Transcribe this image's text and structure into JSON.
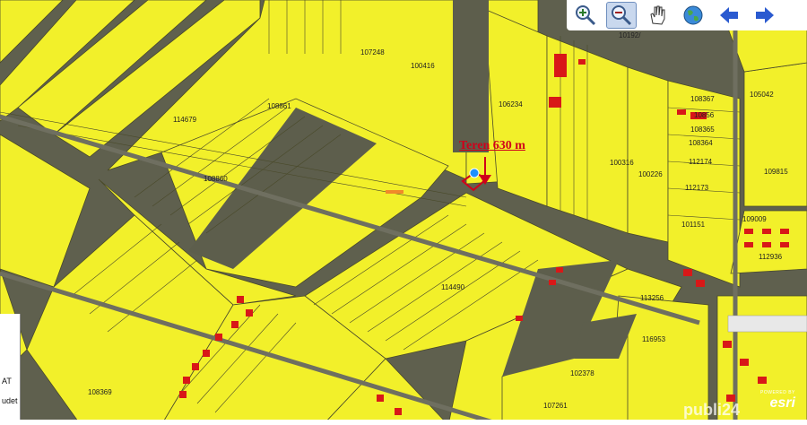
{
  "toolbar": {
    "buttons": [
      {
        "name": "zoom-in-button",
        "icon": "zoom-in-icon"
      },
      {
        "name": "zoom-out-button",
        "icon": "zoom-out-icon",
        "active": true
      },
      {
        "name": "pan-button",
        "icon": "pan-hand-icon"
      },
      {
        "name": "full-extent-button",
        "icon": "globe-icon"
      },
      {
        "name": "previous-extent-button",
        "icon": "arrow-left-icon"
      },
      {
        "name": "next-extent-button",
        "icon": "arrow-right-icon"
      }
    ]
  },
  "annotation": {
    "label": "Teren 630 m",
    "color": "#d0001a"
  },
  "parcels": [
    "107248",
    "100416",
    "10192/",
    "114679",
    "108861",
    "106234",
    "108367",
    "105042",
    "10856",
    "108365",
    "108364",
    "112174",
    "109815",
    "100316",
    "100226",
    "112173",
    "108860",
    "101151",
    "109009",
    "112936",
    "114490",
    "113256",
    "116953",
    "102378",
    "108369",
    "107261"
  ],
  "side_panel": {
    "line1": "AT",
    "line2": "udet"
  },
  "attribution": {
    "powered_by": "POWERED BY",
    "brand": "esri"
  },
  "watermark": "publi24",
  "colors": {
    "parcel_fill": "#f2f02a",
    "parcel_stroke": "#4a4a2a",
    "building": "#d81818",
    "road": "#6f6f60",
    "field_dark": "#5d5e4c",
    "marker": "#1e90ff"
  }
}
